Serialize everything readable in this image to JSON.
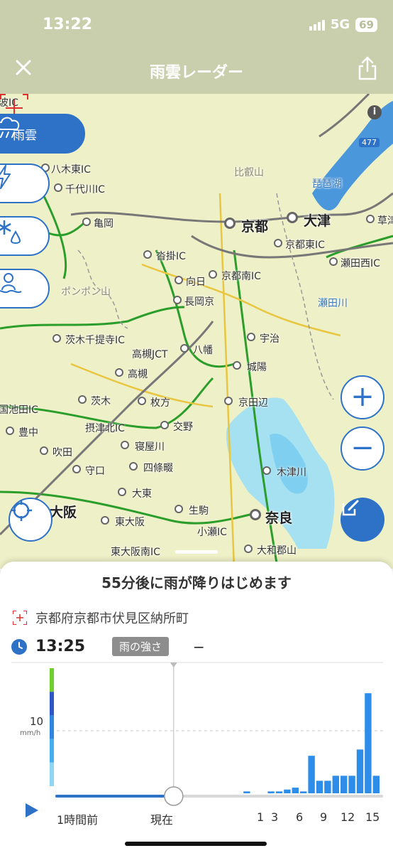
{
  "status_bar": {
    "time": "13:22",
    "network": "5G",
    "battery": "69"
  },
  "header": {
    "title": "雨雲レーダー"
  },
  "map": {
    "layer_buttons": [
      {
        "label": "雨雲",
        "icon": "rain-cloud-icon",
        "active": true
      },
      {
        "label": "",
        "icon": "lightning-icon",
        "active": false
      },
      {
        "label": "",
        "icon": "snow-icon",
        "active": false
      },
      {
        "label": "",
        "icon": "snowman-icon",
        "active": false
      }
    ],
    "places": [
      {
        "name": "波IC"
      },
      {
        "name": "八木東IC"
      },
      {
        "name": "千代川IC"
      },
      {
        "name": "亀岡"
      },
      {
        "name": "比叡山"
      },
      {
        "name": "琵琶湖"
      },
      {
        "name": "京都"
      },
      {
        "name": "大津"
      },
      {
        "name": "草津"
      },
      {
        "name": "京都東IC"
      },
      {
        "name": "沓掛IC"
      },
      {
        "name": "瀬田西IC"
      },
      {
        "name": "向日"
      },
      {
        "name": "京都南IC"
      },
      {
        "name": "ポンポン山"
      },
      {
        "name": "長岡京"
      },
      {
        "name": "瀬田川"
      },
      {
        "name": "茨木千提寺IC"
      },
      {
        "name": "宇治"
      },
      {
        "name": "高槻JCT"
      },
      {
        "name": "八幡"
      },
      {
        "name": "高槻"
      },
      {
        "name": "城陽"
      },
      {
        "name": "茨木"
      },
      {
        "name": "枚方"
      },
      {
        "name": "京田辺"
      },
      {
        "name": "国池田IC"
      },
      {
        "name": "豊中"
      },
      {
        "name": "摂津北IC"
      },
      {
        "name": "交野"
      },
      {
        "name": "吹田"
      },
      {
        "name": "寝屋川"
      },
      {
        "name": "木津川"
      },
      {
        "name": "守口"
      },
      {
        "name": "四條畷"
      },
      {
        "name": "大東"
      },
      {
        "name": "大阪"
      },
      {
        "name": "生駒"
      },
      {
        "name": "奈良"
      },
      {
        "name": "東大阪"
      },
      {
        "name": "小瀬IC"
      },
      {
        "name": "東大阪南IC"
      },
      {
        "name": "大和郡山"
      },
      {
        "name": "477"
      }
    ]
  },
  "sheet": {
    "headline": "55分後に雨が降りはじめます",
    "address": "京都府京都市伏見区納所町",
    "time": "13:25",
    "intensity_label": "雨の強さ",
    "intensity_value": "−"
  },
  "chart_data": {
    "type": "bar",
    "title": "",
    "ylabel": "mm/h",
    "y_tick_labels": [
      "10"
    ],
    "ylim": [
      0,
      20
    ],
    "x_tick_labels": [
      "1時間前",
      "現在",
      "1",
      "3",
      "6",
      "9",
      "12",
      "15"
    ],
    "x_unit": "min relative to now",
    "categories": [
      -60,
      -55,
      -50,
      -45,
      -40,
      -35,
      -30,
      -25,
      -20,
      -15,
      -10,
      -5,
      0,
      5,
      10,
      15,
      20,
      25,
      30,
      35,
      40,
      45,
      50,
      55,
      60,
      65,
      70,
      75,
      80,
      85,
      90,
      95,
      100,
      105,
      110,
      115,
      120,
      125,
      130,
      135,
      140,
      145,
      150,
      155,
      160,
      165,
      170,
      175
    ],
    "values": [
      0,
      0,
      0,
      0,
      0,
      0,
      0,
      0,
      0,
      0,
      0,
      0,
      0,
      0,
      0,
      0,
      0,
      0,
      0,
      0,
      0,
      0,
      0,
      0.3,
      0,
      0,
      0.3,
      0.3,
      0.6,
      0.9,
      0.3,
      6.0,
      2.0,
      2.0,
      2.8,
      2.8,
      2.8,
      7.0,
      16.0,
      2.8
    ],
    "slider_position": "現在",
    "color_scale": [
      "#6fcf2f",
      "#2e56c8",
      "#2e86e0",
      "#49aef0",
      "#8fd6f5"
    ]
  }
}
